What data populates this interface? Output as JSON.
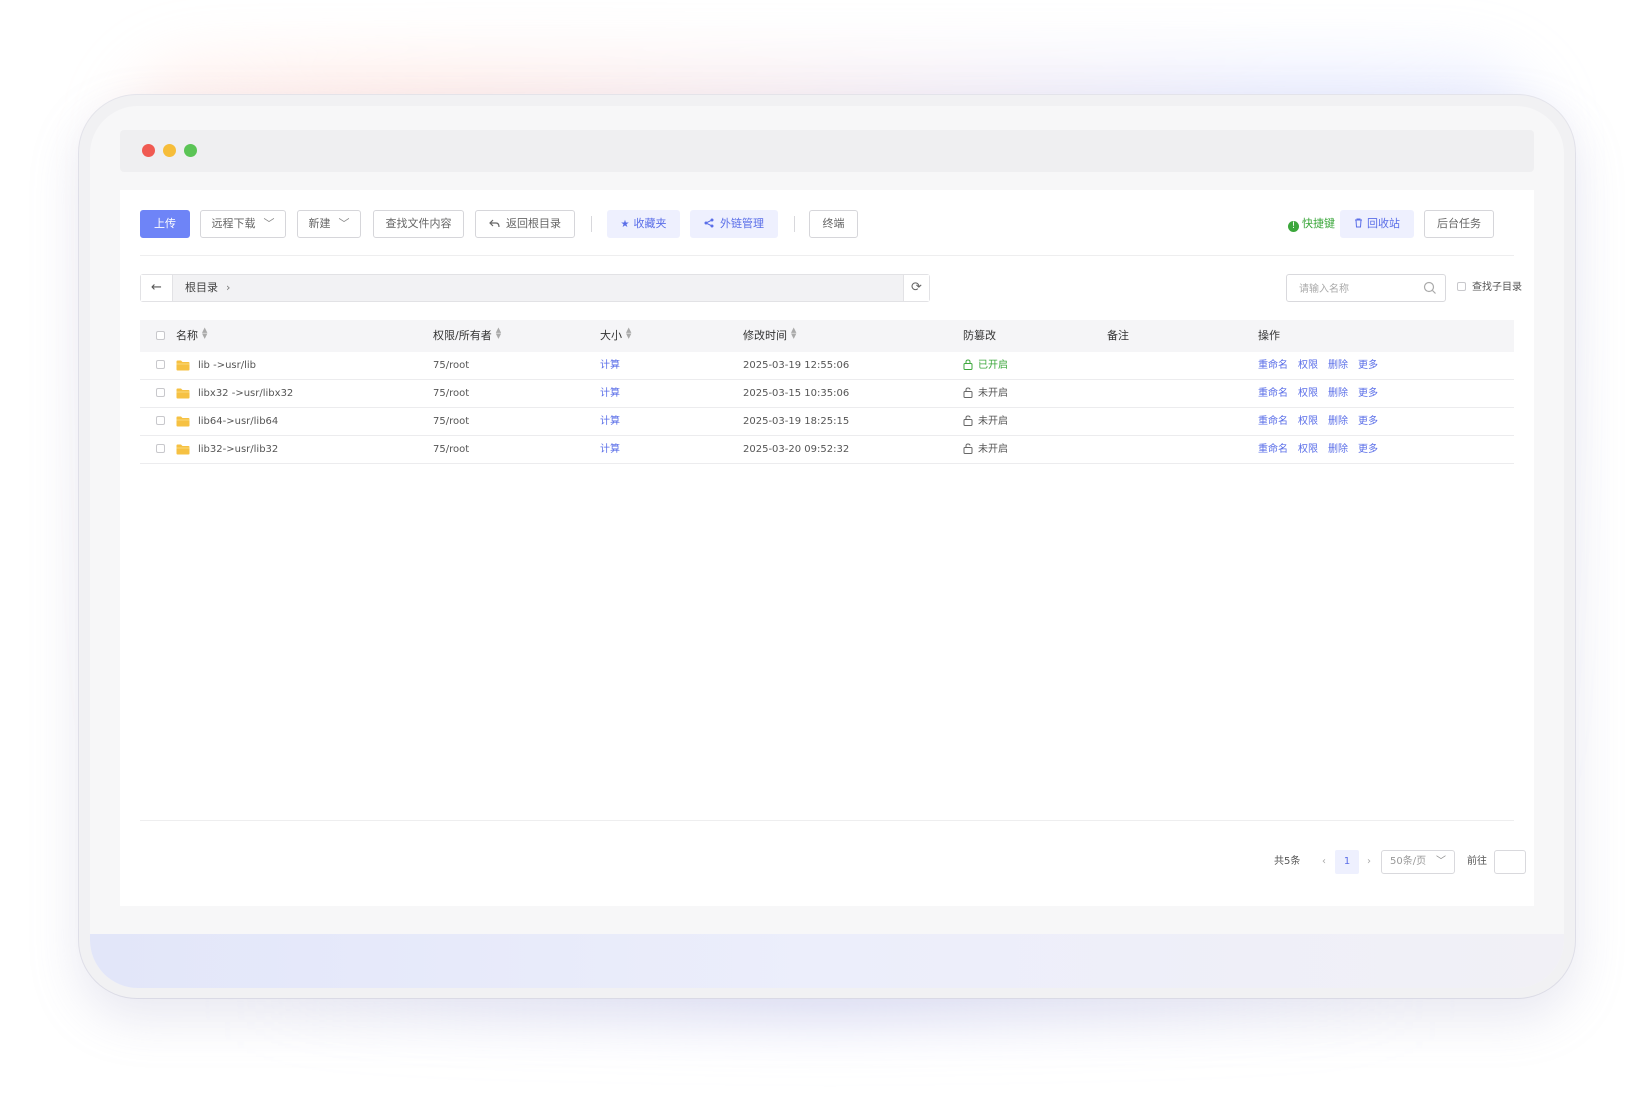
{
  "toolbar": {
    "upload": "上传",
    "remote_download": "远程下载",
    "new": "新建",
    "find_content": "查找文件内容",
    "back_root": "返回根目录",
    "favorites": "收藏夹",
    "external_links": "外链管理",
    "terminal": "终端",
    "hotkey": "快捷键",
    "recycle_bin": "回收站",
    "background_tasks": "后台任务"
  },
  "path": {
    "crumb": "根目录"
  },
  "search": {
    "placeholder": "请输入名称",
    "subdir_label": "查找子目录"
  },
  "table": {
    "headers": {
      "name": "名称",
      "perm_owner": "权限/所有者",
      "size": "大小",
      "mtime": "修改时间",
      "tamper": "防篡改",
      "remark": "备注",
      "actions": "操作"
    },
    "rows": [
      {
        "name": "lib ->usr/lib",
        "perm": "75/root",
        "size": "计算",
        "mtime": "2025-03-19 12:55:06",
        "tamper": "已开启",
        "tamper_on": true
      },
      {
        "name": "libx32 ->usr/libx32",
        "perm": "75/root",
        "size": "计算",
        "mtime": "2025-03-15 10:35:06",
        "tamper": "未开启",
        "tamper_on": false
      },
      {
        "name": "lib64->usr/lib64",
        "perm": "75/root",
        "size": "计算",
        "mtime": "2025-03-19 18:25:15",
        "tamper": "未开启",
        "tamper_on": false
      },
      {
        "name": "lib32->usr/lib32",
        "perm": "75/root",
        "size": "计算",
        "mtime": "2025-03-20 09:52:32",
        "tamper": "未开启",
        "tamper_on": false
      }
    ],
    "actions": {
      "rename": "重命名",
      "permission": "权限",
      "delete": "删除",
      "more": "更多"
    }
  },
  "pagination": {
    "total": "共5条",
    "current_page": "1",
    "page_size": "50条/页",
    "goto": "前往"
  },
  "colors": {
    "primary": "#6e84f7",
    "link": "#5a6ee8",
    "success": "#3ba73b",
    "folder": "#f6c142"
  },
  "icons": {
    "back": "arrow-left-icon",
    "refresh": "refresh-icon",
    "search": "search-icon",
    "favorites": "star-icon",
    "share": "share-icon",
    "return": "return-arrow-icon",
    "recycle": "trash-icon",
    "folder": "folder-icon",
    "lock": "lock-icon"
  }
}
